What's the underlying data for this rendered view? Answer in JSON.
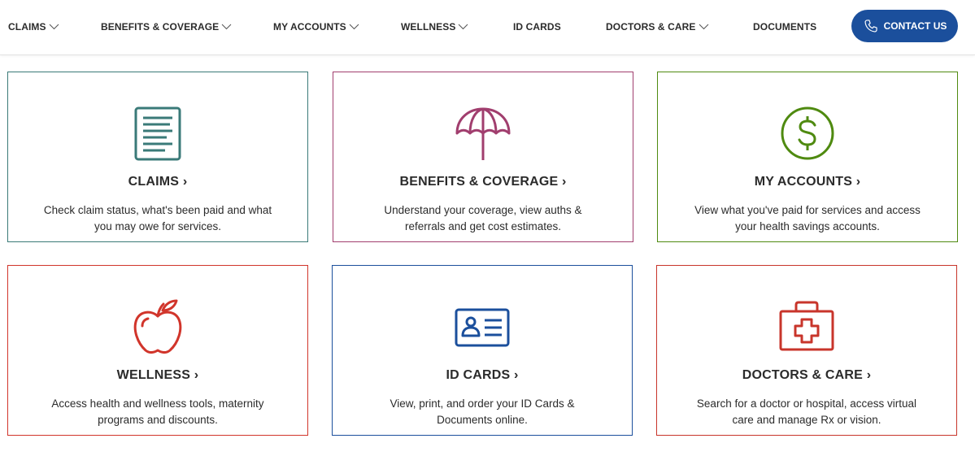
{
  "nav": {
    "items": [
      {
        "label": "CLAIMS",
        "dropdown": true
      },
      {
        "label": "BENEFITS & COVERAGE",
        "dropdown": true
      },
      {
        "label": "MY ACCOUNTS",
        "dropdown": true
      },
      {
        "label": "WELLNESS",
        "dropdown": true
      },
      {
        "label": "ID CARDS",
        "dropdown": false
      },
      {
        "label": "DOCTORS & CARE",
        "dropdown": true
      },
      {
        "label": "DOCUMENTS",
        "dropdown": false
      }
    ],
    "contact_label": "CONTACT US"
  },
  "colors": {
    "brand": "#1b4f9c",
    "claims": "#3a7a78",
    "benefits": "#a13e6e",
    "accounts": "#4f8a10",
    "wellness": "#d1352b",
    "idcards": "#1b4f9c",
    "doctors": "#c8352b"
  },
  "cards": [
    {
      "title": "CLAIMS ›",
      "icon": "document-icon",
      "desc": "Check claim status, what's been paid and what you may owe for services."
    },
    {
      "title": "BENEFITS & COVERAGE ›",
      "icon": "umbrella-icon",
      "desc": "Understand your coverage, view auths & referrals and get cost estimates."
    },
    {
      "title": "MY ACCOUNTS ›",
      "icon": "dollar-icon",
      "desc": "View what you've paid for services and access your health savings accounts."
    },
    {
      "title": "WELLNESS ›",
      "icon": "apple-icon",
      "desc": "Access health and wellness tools, maternity programs and discounts."
    },
    {
      "title": "ID CARDS ›",
      "icon": "id-card-icon",
      "desc": "View, print, and order your ID Cards & Documents online."
    },
    {
      "title": "DOCTORS & CARE ›",
      "icon": "first-aid-kit-icon",
      "desc": "Search for a doctor or hospital, access virtual care and manage Rx or vision."
    }
  ]
}
